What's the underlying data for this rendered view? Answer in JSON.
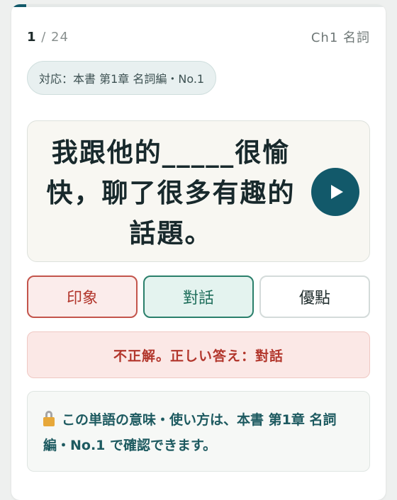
{
  "progress": {
    "current": "1",
    "separator": " / ",
    "total": "24",
    "fraction": 0.04
  },
  "chapter_tag": "Ch1 名詞",
  "reference_chip": "対応：本書 第1章 名詞編・No.1",
  "question": {
    "text": "我跟他的_____很愉快，聊了很多有趣的話題。"
  },
  "play_icon": "play-icon",
  "choices": [
    {
      "label": "印象",
      "state": "wrong"
    },
    {
      "label": "對話",
      "state": "correct"
    },
    {
      "label": "優點",
      "state": "neutral"
    }
  ],
  "result": "不正解。正しい答え：對話",
  "note": {
    "icon": "lock-icon",
    "text": "この単語の意味・使い方は、本書 第1章 名詞編・No.1 で確認できます。"
  },
  "colors": {
    "accent": "#12596a",
    "wrong": "#b2362c",
    "correct": "#2a7f6b",
    "note_text": "#1d5a60"
  }
}
